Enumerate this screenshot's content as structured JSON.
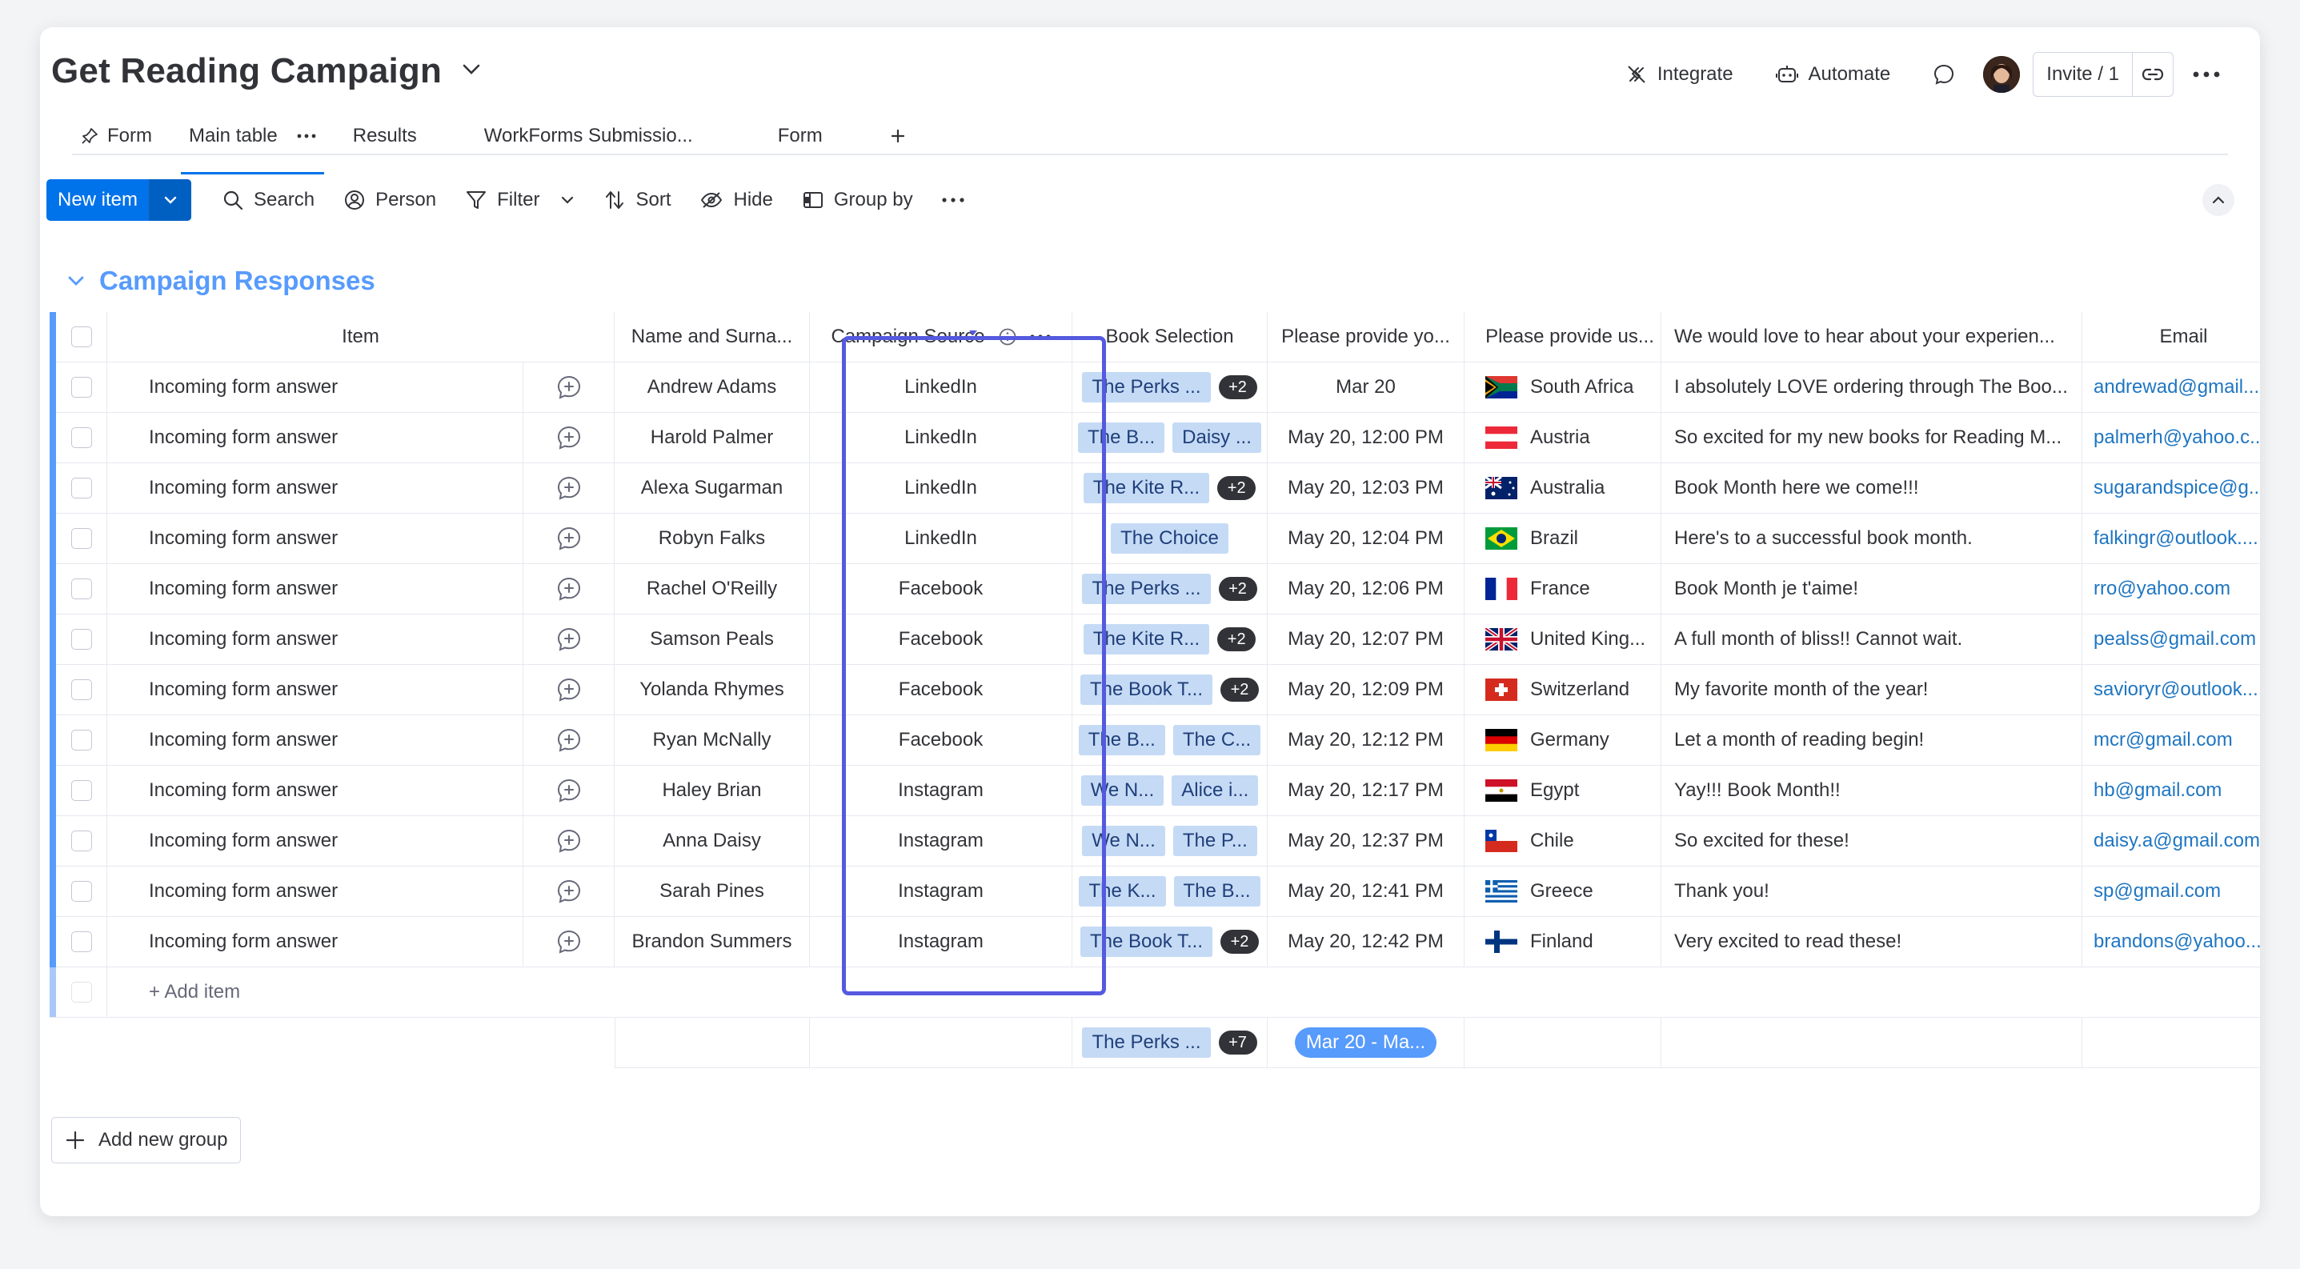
{
  "header": {
    "title": "Get Reading Campaign",
    "integrate": "Integrate",
    "automate": "Automate",
    "invite": "Invite / 1"
  },
  "tabs": [
    "Form",
    "Main table",
    "Results",
    "WorkForms Submissio...",
    "Form"
  ],
  "toolbar": {
    "new_item": "New item",
    "search": "Search",
    "person": "Person",
    "filter": "Filter",
    "sort": "Sort",
    "hide": "Hide",
    "group_by": "Group by"
  },
  "group": {
    "title": "Campaign Responses",
    "color": "#579bfc",
    "columns": {
      "item": "Item",
      "name": "Name and Surna...",
      "source": "Campaign Source",
      "book": "Book Selection",
      "date": "Please provide yo...",
      "country": "Please provide us...",
      "experience": "We would love to hear about your experien...",
      "email": "Email"
    },
    "rows": [
      {
        "item": "Incoming form answer",
        "name": "Andrew Adams",
        "source": "LinkedIn",
        "book1": "The Perks ...",
        "book2": "",
        "more": "+2",
        "date": "Mar 20",
        "country": "South Africa",
        "flag": "za",
        "experience": "I absolutely LOVE ordering through The Boo...",
        "email": "andrewad@gmail...."
      },
      {
        "item": "Incoming form answer",
        "name": "Harold Palmer",
        "source": "LinkedIn",
        "book1": "The B...",
        "book2": "Daisy ...",
        "more": "",
        "date": "May 20, 12:00 PM",
        "country": "Austria",
        "flag": "at",
        "experience": "So excited for my new books for Reading M...",
        "email": "palmerh@yahoo.c..."
      },
      {
        "item": "Incoming form answer",
        "name": "Alexa Sugarman",
        "source": "LinkedIn",
        "book1": "The Kite R...",
        "book2": "",
        "more": "+2",
        "date": "May 20, 12:03 PM",
        "country": "Australia",
        "flag": "au",
        "experience": "Book Month here we come!!!",
        "email": "sugarandspice@g..."
      },
      {
        "item": "Incoming form answer",
        "name": "Robyn Falks",
        "source": "LinkedIn",
        "book1": "The Choice",
        "book2": "",
        "more": "",
        "date": "May 20, 12:04 PM",
        "country": "Brazil",
        "flag": "br",
        "experience": "Here's to a successful book month.",
        "email": "falkingr@outlook...."
      },
      {
        "item": "Incoming form answer",
        "name": "Rachel O'Reilly",
        "source": "Facebook",
        "book1": "The Perks ...",
        "book2": "",
        "more": "+2",
        "date": "May 20, 12:06 PM",
        "country": "France",
        "flag": "fr",
        "experience": "Book Month je t'aime!",
        "email": "rro@yahoo.com"
      },
      {
        "item": "Incoming form answer",
        "name": "Samson Peals",
        "source": "Facebook",
        "book1": "The Kite R...",
        "book2": "",
        "more": "+2",
        "date": "May 20, 12:07 PM",
        "country": "United King...",
        "flag": "gb",
        "experience": "A full month of bliss!! Cannot wait.",
        "email": "pealss@gmail.com"
      },
      {
        "item": "Incoming form answer",
        "name": "Yolanda Rhymes",
        "source": "Facebook",
        "book1": "The Book T...",
        "book2": "",
        "more": "+2",
        "date": "May 20, 12:09 PM",
        "country": "Switzerland",
        "flag": "ch",
        "experience": "My favorite month of the year!",
        "email": "savioryr@outlook...."
      },
      {
        "item": "Incoming form answer",
        "name": "Ryan McNally",
        "source": "Facebook",
        "book1": "The B...",
        "book2": "The C...",
        "more": "",
        "date": "May 20, 12:12 PM",
        "country": "Germany",
        "flag": "de",
        "experience": "Let a month of reading begin!",
        "email": "mcr@gmail.com"
      },
      {
        "item": "Incoming form answer",
        "name": "Haley Brian",
        "source": "Instagram",
        "book1": "We N...",
        "book2": "Alice i...",
        "more": "",
        "date": "May 20, 12:17 PM",
        "country": "Egypt",
        "flag": "eg",
        "experience": "Yay!!! Book Month!!",
        "email": "hb@gmail.com"
      },
      {
        "item": "Incoming form answer",
        "name": "Anna Daisy",
        "source": "Instagram",
        "book1": "We N...",
        "book2": "The P...",
        "more": "",
        "date": "May 20, 12:37 PM",
        "country": "Chile",
        "flag": "cl",
        "experience": "So excited for these!",
        "email": "daisy.a@gmail.com"
      },
      {
        "item": "Incoming form answer",
        "name": "Sarah Pines",
        "source": "Instagram",
        "book1": "The K...",
        "book2": "The B...",
        "more": "",
        "date": "May 20, 12:41 PM",
        "country": "Greece",
        "flag": "gr",
        "experience": "Thank you!",
        "email": "sp@gmail.com"
      },
      {
        "item": "Incoming form answer",
        "name": "Brandon Summers",
        "source": "Instagram",
        "book1": "The Book T...",
        "book2": "",
        "more": "+2",
        "date": "May 20, 12:42 PM",
        "country": "Finland",
        "flag": "fi",
        "experience": "Very excited to read these!",
        "email": "brandons@yahoo...."
      }
    ],
    "add_item": "+ Add item",
    "summary": {
      "book": "The Perks ...",
      "book_more": "+7",
      "date_range": "Mar 20 - Ma..."
    }
  },
  "add_group": "Add new group",
  "colors": {
    "primary": "#0073ea",
    "highlight": "#5559df",
    "tag": "#c5daf5",
    "link": "#1f76c2"
  }
}
